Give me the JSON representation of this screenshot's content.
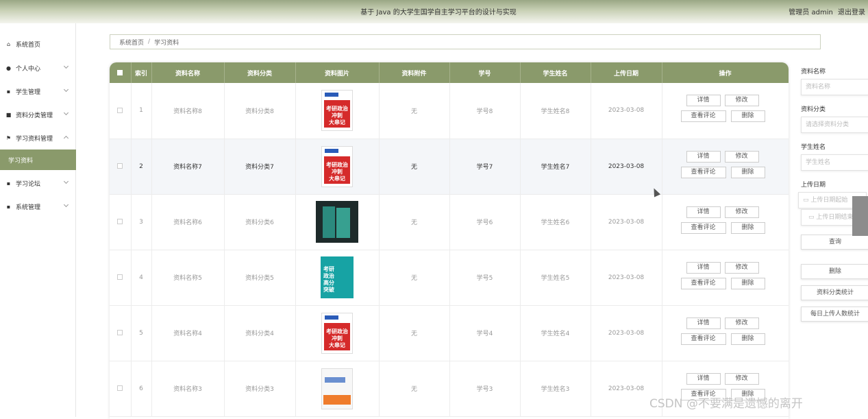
{
  "header": {
    "title": "基于 Java 的大学生国学自主学习平台的设计与实现",
    "user": "管理员 admin",
    "logout": "退出登录"
  },
  "sidebar": {
    "items": [
      {
        "label": "系统首页",
        "icon": "home-icon"
      },
      {
        "label": "个人中心",
        "icon": "person-icon"
      },
      {
        "label": "学生管理",
        "icon": "grid-icon"
      },
      {
        "label": "资料分类管理",
        "icon": "briefcase-icon"
      },
      {
        "label": "学习资料管理",
        "icon": "flag-icon"
      },
      {
        "label": "学习资料",
        "icon": ""
      },
      {
        "label": "学习论坛",
        "icon": "grid-icon"
      },
      {
        "label": "系统管理",
        "icon": "grid-icon"
      }
    ]
  },
  "breadcrumb": {
    "home": "系统首页",
    "sep": "/",
    "current": "学习资料"
  },
  "table": {
    "headers": [
      "索引",
      "资料名称",
      "资料分类",
      "资料图片",
      "资料附件",
      "学号",
      "学生姓名",
      "上传日期",
      "操作"
    ],
    "buttons": {
      "detail": "详情",
      "edit": "修改",
      "review": "查看评论",
      "delete": "删除"
    },
    "rows": [
      {
        "idx": "1",
        "name": "资料名称8",
        "cat": "资料分类8",
        "img": "red-book",
        "att": "无",
        "sid": "学号8",
        "sname": "学生姓名8",
        "date": "2023-03-08"
      },
      {
        "idx": "2",
        "name": "资料名称7",
        "cat": "资料分类7",
        "img": "red-book",
        "att": "无",
        "sid": "学号7",
        "sname": "学生姓名7",
        "date": "2023-03-08"
      },
      {
        "idx": "3",
        "name": "资料名称6",
        "cat": "资料分类6",
        "img": "dark-book",
        "att": "无",
        "sid": "学号6",
        "sname": "学生姓名6",
        "date": "2023-03-08"
      },
      {
        "idx": "4",
        "name": "资料名称5",
        "cat": "资料分类5",
        "img": "teal-book",
        "att": "无",
        "sid": "学号5",
        "sname": "学生姓名5",
        "date": "2023-03-08"
      },
      {
        "idx": "5",
        "name": "资料名称4",
        "cat": "资料分类4",
        "img": "red-book",
        "att": "无",
        "sid": "学号4",
        "sname": "学生姓名4",
        "date": "2023-03-08"
      },
      {
        "idx": "6",
        "name": "资料名称3",
        "cat": "资料分类3",
        "img": "white-book",
        "att": "无",
        "sid": "学号3",
        "sname": "学生姓名3",
        "date": "2023-03-08"
      }
    ],
    "book_text": {
      "red": "考研政治\n冲刺\n大串记",
      "teal": "考研\n政治\n高分\n突破"
    }
  },
  "search": {
    "name_label": "资料名称",
    "name_placeholder": "资料名称",
    "cat_label": "资料分类",
    "cat_placeholder": "请选择资料分类",
    "student_label": "学生姓名",
    "student_placeholder": "学生姓名",
    "date_label": "上传日期",
    "date_start": "上传日期起始",
    "date_end": "上传日期结束",
    "query": "查询",
    "delete": "删除",
    "stat1": "资料分类统计",
    "stat2": "每日上传人数统计"
  },
  "watermark": "CSDN @不要满是遗憾的离开",
  "colors": {
    "accent": "#8a9a6b",
    "highlight_row": "#f4f6f9"
  }
}
